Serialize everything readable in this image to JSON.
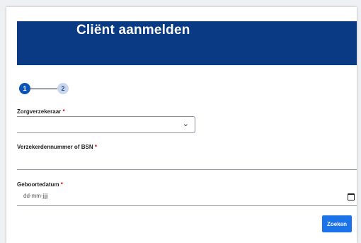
{
  "header": {
    "title": "Cliënt aanmelden"
  },
  "stepper": {
    "steps": [
      "1",
      "2"
    ],
    "current": 1
  },
  "form": {
    "insurer": {
      "label": "Zorgverzekeraar",
      "required_mark": "*",
      "value": ""
    },
    "id_number": {
      "label": "Verzekerdennummer of BSN",
      "required_mark": "*",
      "value": ""
    },
    "birthdate": {
      "label": "Geboortedatum",
      "required_mark": "*",
      "placeholder": "dd-mm-jjjj"
    }
  },
  "actions": {
    "search_label": "Zoeken"
  },
  "colors": {
    "banner": "#0b3a84",
    "primary": "#1a73e8",
    "required": "#d0021b"
  },
  "icons": {
    "select_chevron": "chevron-down-icon",
    "date_picker": "calendar-icon"
  }
}
